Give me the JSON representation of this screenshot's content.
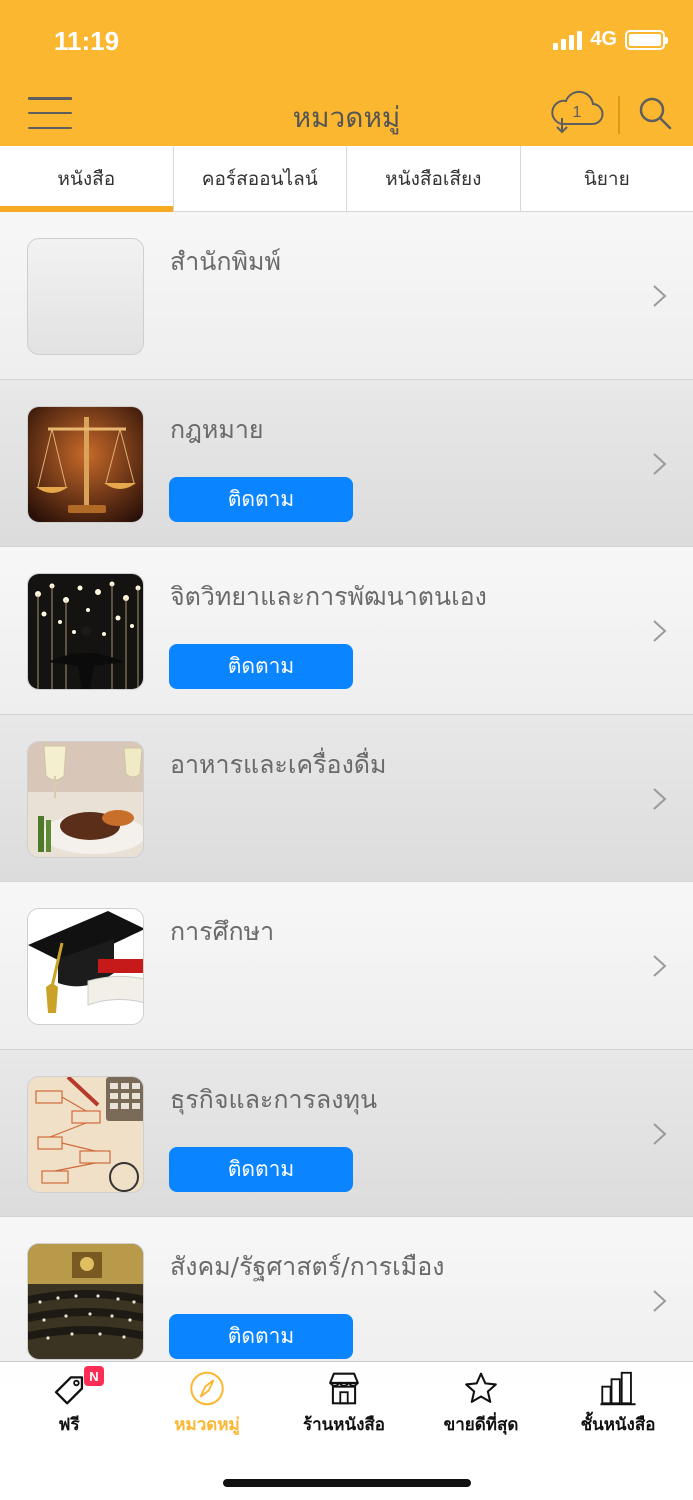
{
  "status_bar": {
    "time": "11:19",
    "network": "4G"
  },
  "header": {
    "title": "หมวดหมู่",
    "cloud_badge": "1",
    "colors": {
      "bar": "#fcb731",
      "icon": "#5e5e5e"
    }
  },
  "tabs": [
    {
      "label": "หนังสือ",
      "active": true
    },
    {
      "label": "คอร์สออนไลน์",
      "active": false
    },
    {
      "label": "หนังสือเสียง",
      "active": false
    },
    {
      "label": "นิยาย",
      "active": false
    }
  ],
  "follow_label": "ติดตาม",
  "categories": [
    {
      "title": "สำนักพิมพ์",
      "image": "blank-thumbnail",
      "follow": false
    },
    {
      "title": "กฎหมาย",
      "image": "scales-of-justice",
      "follow": true
    },
    {
      "title": "จิตวิทยาและการพัฒนาตนเอง",
      "image": "person-among-lights",
      "follow": true
    },
    {
      "title": "อาหารและเครื่องดื่ม",
      "image": "food-and-wine",
      "follow": false
    },
    {
      "title": "การศึกษา",
      "image": "graduation-cap-diploma",
      "follow": false
    },
    {
      "title": "ธุรกิจและการลงทุน",
      "image": "flowchart-calculator",
      "follow": true
    },
    {
      "title": "สังคม/รัฐศาสตร์/การเมือง",
      "image": "parliament-chamber",
      "follow": true
    }
  ],
  "bottom_nav": [
    {
      "label": "ฟรี",
      "icon": "tag-icon",
      "badge": "N",
      "active": false
    },
    {
      "label": "หมวดหมู่",
      "icon": "compass-icon",
      "active": true
    },
    {
      "label": "ร้านหนังสือ",
      "icon": "store-icon",
      "active": false
    },
    {
      "label": "ขายดีที่สุด",
      "icon": "star-icon",
      "active": false
    },
    {
      "label": "ชั้นหนังสือ",
      "icon": "bookshelf-icon",
      "active": false
    }
  ],
  "colors": {
    "accent": "#fcb731",
    "follow_button": "#0a84ff",
    "active_tab_underline": "#f6a922"
  }
}
